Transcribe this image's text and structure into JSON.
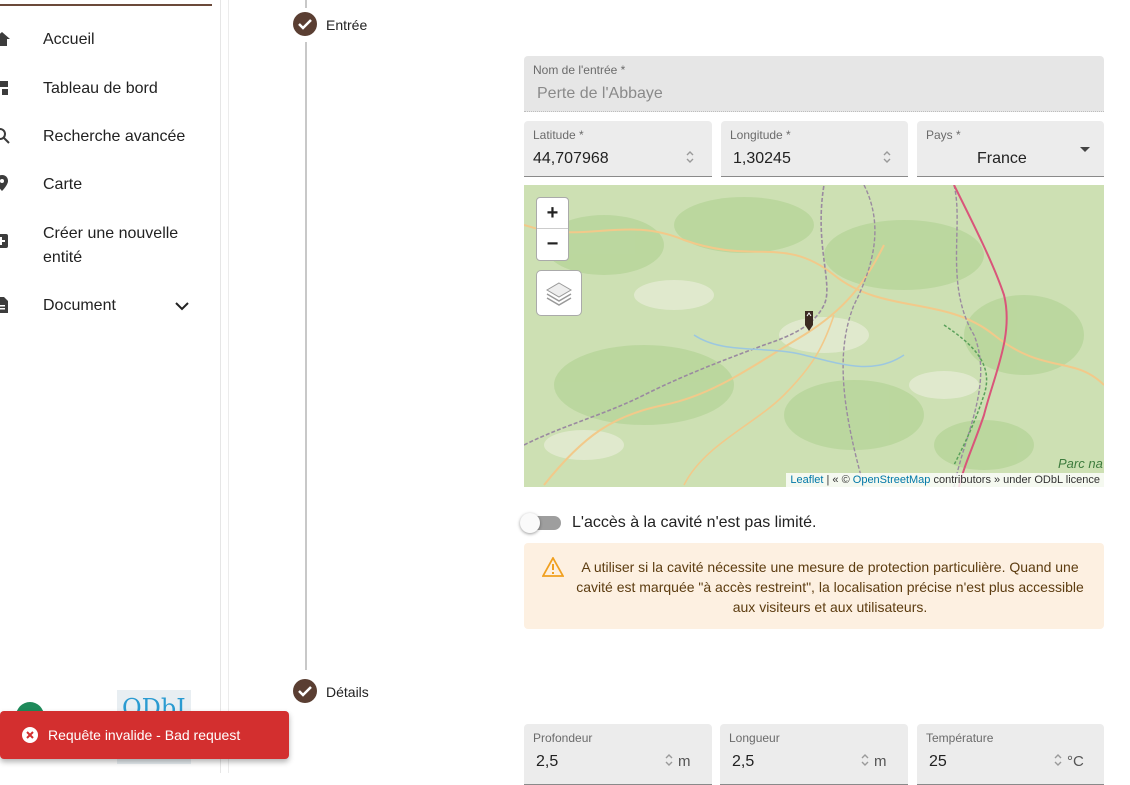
{
  "sidebar": {
    "items": [
      {
        "label": "Accueil",
        "icon": "home-icon"
      },
      {
        "label": "Tableau de bord",
        "icon": "dashboard-icon"
      },
      {
        "label": "Recherche avancée",
        "icon": "search-icon"
      },
      {
        "label": "Carte",
        "icon": "map-pin-icon"
      },
      {
        "label": "Créer une nouvelle entité",
        "icon": "add-box-icon"
      },
      {
        "label": "Document",
        "icon": "document-icon"
      }
    ],
    "odbl_logo": "ODbL"
  },
  "steps": {
    "entry": "Entrée",
    "details": "Détails"
  },
  "entry_form": {
    "name_label": "Nom de l'entrée *",
    "name_value": "Perte de l'Abbaye",
    "latitude_label": "Latitude *",
    "latitude_value": "44,707968",
    "longitude_label": "Longitude *",
    "longitude_value": "1,30245",
    "country_label": "Pays *",
    "country_value": "France"
  },
  "map": {
    "zoom_in": "+",
    "zoom_out": "−",
    "attribution_leaflet": "Leaflet",
    "attribution_mid": " | « © ",
    "attribution_osm": "OpenStreetMap",
    "attribution_tail": " contributors » under ODbL licence",
    "parc_label": "Parc na"
  },
  "access": {
    "toggle_label": "L'accès à la cavité n'est pas limité.",
    "warning_text": "A utiliser si la cavité nécessite une mesure de protection particulière. Quand une cavité est marquée \"à accès restreint\", la localisation précise n'est plus accessible aux visiteurs et aux utilisateurs."
  },
  "details_form": {
    "depth_label": "Profondeur",
    "depth_value": "2,5",
    "depth_unit": "m",
    "length_label": "Longueur",
    "length_value": "2,5",
    "length_unit": "m",
    "temp_label": "Température",
    "temp_value": "25",
    "temp_unit": "°C"
  },
  "toast": {
    "message": "Requête invalide - Bad request"
  },
  "colors": {
    "primary": "#5a3e32",
    "error": "#d32f2f",
    "warning_bg": "#fdf0e1",
    "warning_icon": "#f0a020"
  }
}
